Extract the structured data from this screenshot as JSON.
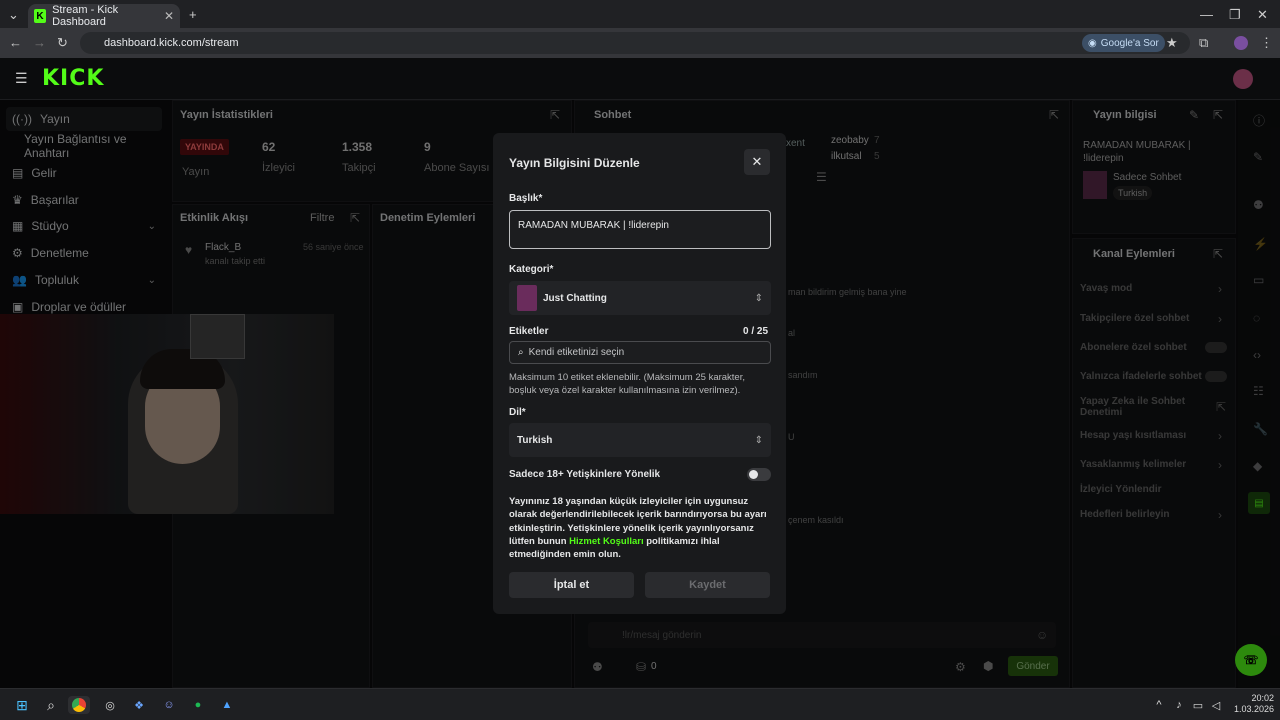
{
  "browser": {
    "tab_title": "Stream - Kick Dashboard",
    "url": "dashboard.kick.com/stream",
    "google_button": "Google'a Sor"
  },
  "brand": {
    "logo": "KICK",
    "accent": "#53fc18"
  },
  "sidebar": {
    "items": [
      {
        "label": "Yayın",
        "icon": "broadcast-icon"
      },
      {
        "label": "Yayın Bağlantısı ve Anahtarı",
        "icon": ""
      },
      {
        "label": "Gelir",
        "icon": "revenue-icon"
      },
      {
        "label": "Başarılar",
        "icon": "trophy-icon"
      },
      {
        "label": "Stüdyo",
        "icon": "studio-icon"
      },
      {
        "label": "Denetleme",
        "icon": "moderation-icon"
      },
      {
        "label": "Topluluk",
        "icon": "community-icon"
      },
      {
        "label": "Droplar ve ödüller",
        "icon": "drops-icon"
      }
    ]
  },
  "stats": {
    "title": "Yayın İstatistikleri",
    "status": "YAYINDA",
    "status_label": "Yayın",
    "viewers": "62",
    "viewers_label": "İzleyici",
    "followers": "1.358",
    "followers_label": "Takipçi",
    "subs": "9",
    "subs_label": "Abone Sayısı"
  },
  "activity": {
    "title": "Etkinlik Akışı",
    "filter": "Filtre",
    "item_user": "Flack_B",
    "item_text": "kanalı takip etti",
    "item_time": "56 saniye önce"
  },
  "moderation": {
    "title": "Denetim Eylemleri"
  },
  "chat": {
    "title": "Sohbet",
    "user1": "zeobaby",
    "user1_count": "7",
    "user2": "ilkutsal",
    "user2_count": "5",
    "user0": "xent",
    "frag1": "man bildirim gelmiş bana yine",
    "frag2": "al",
    "frag3": "sandım",
    "frag4": "U",
    "frag5": "çenem kasıldı",
    "input_placeholder": "!lr/mesaj gönderin",
    "points": "0",
    "send": "Gönder"
  },
  "stream_info": {
    "title": "Yayın bilgisi",
    "stream_title": "RAMADAN MUBARAK | !liderepin",
    "category": "Sadece Sohbet",
    "tag": "Turkish"
  },
  "channel_actions": {
    "title": "Kanal Eylemleri",
    "items": [
      {
        "label": "Yavaş mod"
      },
      {
        "label": "Takipçilere özel sohbet"
      },
      {
        "label": "Abonelere özel sohbet"
      },
      {
        "label": "Yalnızca ifadelerle sohbet"
      },
      {
        "label": "Yapay Zeka ile Sohbet Denetimi"
      },
      {
        "label": "Hesap yaşı kısıtlaması"
      },
      {
        "label": "Yasaklanmış kelimeler"
      },
      {
        "label": "İzleyici Yönlendir"
      },
      {
        "label": "Hedefleri belirleyin"
      }
    ]
  },
  "modal": {
    "title": "Yayın Bilgisini Düzenle",
    "title_label": "Başlık*",
    "title_value": "RAMADAN MUBARAK | !liderepin",
    "category_label": "Kategori*",
    "category_value": "Just Chatting",
    "tags_label": "Etiketler",
    "tags_count": "0 / 25",
    "tags_placeholder": "Kendi etiketinizi seçin",
    "tags_help": "Maksimum 10 etiket eklenebilir. (Maksimum 25 karakter, boşluk veya özel karakter kullanılmasına izin verilmez).",
    "lang_label": "Dil*",
    "lang_value": "Turkish",
    "adult_label": "Sadece 18+ Yetişkinlere Yönelik",
    "adult_help_1": "Yayınınız 18 yaşından küçük izleyiciler için uygunsuz olarak değerlendirilebilecek içerik barındırıyorsa bu ayarı etkinleştirin. Yetişkinlere yönelik içerik yayınlıyorsanız lütfen bunun ",
    "adult_help_link": "Hizmet Koşulları",
    "adult_help_2": " politikamızı ihlal etmediğinden emin olun.",
    "cancel": "İptal et",
    "save": "Kaydet"
  },
  "taskbar": {
    "time": "20:02",
    "date": "1.03.2026"
  }
}
